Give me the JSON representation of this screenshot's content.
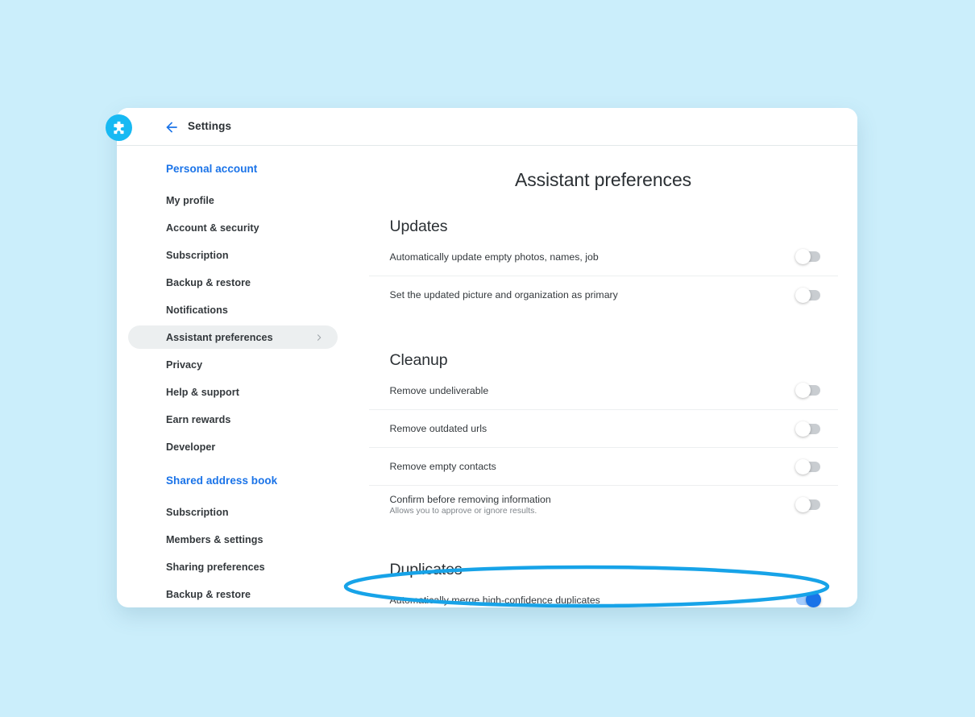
{
  "app": {
    "logo_icon": "medical-cross-circle-icon",
    "accent_blue": "#1a73e8",
    "logo_cyan": "#17b9f3",
    "highlight_color": "#17a3e8",
    "page_background": "#cbeefb"
  },
  "header": {
    "back_icon": "arrow-left-icon",
    "title": "Settings"
  },
  "sidebar": {
    "groups": [
      {
        "heading": "Personal account",
        "items": [
          {
            "label": "My profile",
            "selected": false
          },
          {
            "label": "Account & security",
            "selected": false
          },
          {
            "label": "Subscription",
            "selected": false
          },
          {
            "label": "Backup & restore",
            "selected": false
          },
          {
            "label": "Notifications",
            "selected": false
          },
          {
            "label": "Assistant preferences",
            "selected": true,
            "chevron": "chevron-right-icon"
          },
          {
            "label": "Privacy",
            "selected": false
          },
          {
            "label": "Help & support",
            "selected": false
          },
          {
            "label": "Earn rewards",
            "selected": false
          },
          {
            "label": "Developer",
            "selected": false
          }
        ]
      },
      {
        "heading": "Shared address book",
        "items": [
          {
            "label": "Subscription",
            "selected": false
          },
          {
            "label": "Members & settings",
            "selected": false
          },
          {
            "label": "Sharing preferences",
            "selected": false
          },
          {
            "label": "Backup & restore",
            "selected": false
          }
        ]
      }
    ]
  },
  "main": {
    "page_title": "Assistant preferences",
    "sections": [
      {
        "title": "Updates",
        "rows": [
          {
            "label": "Automatically update empty photos, names, job",
            "sub": "",
            "toggle": "off"
          },
          {
            "label": "Set the updated picture and organization as primary",
            "sub": "",
            "toggle": "off"
          }
        ]
      },
      {
        "title": "Cleanup",
        "rows": [
          {
            "label": "Remove undeliverable",
            "sub": "",
            "toggle": "off"
          },
          {
            "label": "Remove outdated urls",
            "sub": "",
            "toggle": "off"
          },
          {
            "label": "Remove empty contacts",
            "sub": "",
            "toggle": "off"
          },
          {
            "label": "Confirm before removing information",
            "sub": "Allows you to approve or ignore results.",
            "toggle": "off"
          }
        ]
      },
      {
        "title": "Duplicates",
        "rows": [
          {
            "label": "Automatically merge high-confidence duplicates",
            "sub": "",
            "toggle": "on",
            "highlighted": true
          }
        ]
      }
    ]
  }
}
